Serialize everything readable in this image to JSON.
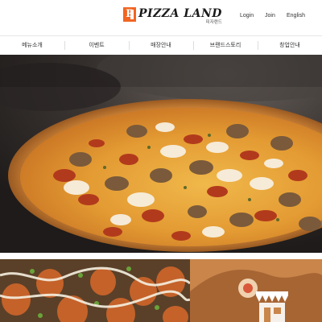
{
  "brand": {
    "name": "PIZZA LAND",
    "subtitle": "피자랜드",
    "mark": "P",
    "accent": "#f26522"
  },
  "utility": {
    "login": "Login",
    "join": "Join",
    "language": "English"
  },
  "nav": {
    "items": [
      {
        "label": "메뉴소개"
      },
      {
        "label": "이벤트"
      },
      {
        "label": "매장안내"
      },
      {
        "label": "브랜드스토리"
      },
      {
        "label": "창업안내"
      }
    ]
  },
  "hero": {
    "image": "pizza-photo"
  },
  "promos": [
    {
      "image": "meatball-snack-photo"
    },
    {
      "image": "storefront-illustration",
      "icon": "store-awning-icon"
    }
  ]
}
